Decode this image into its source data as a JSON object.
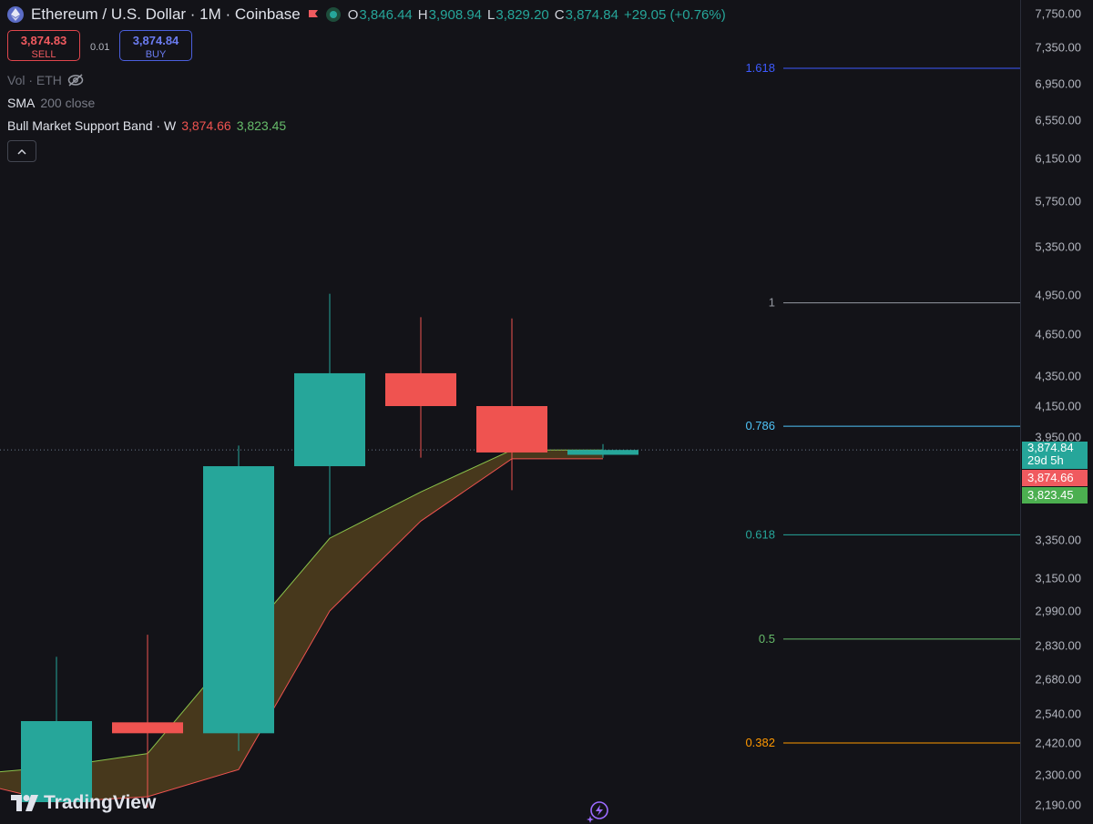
{
  "header": {
    "symbol": "Ethereum / U.S. Dollar · 1M · Coinbase",
    "ohlc": {
      "o_key": "O",
      "o": "3,846.44",
      "h_key": "H",
      "h": "3,908.94",
      "l_key": "L",
      "l": "3,829.20",
      "c_key": "C",
      "c": "3,874.84",
      "change": "+29.05 (+0.76%)"
    }
  },
  "trade": {
    "sell_price": "3,874.83",
    "sell_label": "SELL",
    "spread": "0.01",
    "buy_price": "3,874.84",
    "buy_label": "BUY"
  },
  "legend": {
    "vol": "Vol · ETH",
    "sma_name": "SMA",
    "sma_args": "200 close",
    "bmsb_name": "Bull Market Support Band · W",
    "bmsb_v1": "3,874.66",
    "bmsb_v2": "3,823.45"
  },
  "branding": {
    "logo_text": "TradingView"
  },
  "colors": {
    "up": "#26a69a",
    "down": "#ef5350",
    "band_fill": "#4a3a1c",
    "band_upper": "#8bc34a",
    "band_lower": "#ef5350"
  },
  "axis_ticks": [
    "7,750.00",
    "7,350.00",
    "6,950.00",
    "6,550.00",
    "6,150.00",
    "5,750.00",
    "5,350.00",
    "4,950.00",
    "4,650.00",
    "4,350.00",
    "4,150.00",
    "3,950.00",
    "3,350.00",
    "3,150.00",
    "2,990.00",
    "2,830.00",
    "2,680.00",
    "2,540.00",
    "2,420.00",
    "2,300.00",
    "2,190.00"
  ],
  "price_tags": {
    "last": "3,874.84",
    "countdown": "29d 5h",
    "band_red": "3,874.66",
    "band_green": "3,823.45"
  },
  "chart_data": {
    "type": "candlestick",
    "series": [
      {
        "name": "Ethereum / U.S. Dollar",
        "ohlc": [
          {
            "o": 2200,
            "h": 2780,
            "l": 2180,
            "c": 2510
          },
          {
            "o": 2505,
            "h": 2880,
            "l": 2180,
            "c": 2460
          },
          {
            "o": 2460,
            "h": 3900,
            "l": 2390,
            "c": 3780
          },
          {
            "o": 3780,
            "h": 4960,
            "l": 3380,
            "c": 4370
          },
          {
            "o": 4370,
            "h": 4780,
            "l": 3830,
            "c": 4150
          },
          {
            "o": 4150,
            "h": 4770,
            "l": 3640,
            "c": 3860
          },
          {
            "o": 3846.44,
            "h": 3908.94,
            "l": 3829.2,
            "c": 3874.84
          }
        ]
      },
      {
        "name": "Bull Market Support Band upper",
        "values": [
          2300,
          2330,
          2380,
          2830,
          3360,
          3630,
          3874.66,
          3874.66
        ]
      },
      {
        "name": "Bull Market Support Band lower",
        "values": [
          2280,
          2200,
          2220,
          2320,
          2990,
          3460,
          3823.45,
          3823.45
        ]
      }
    ],
    "fib_levels": [
      {
        "label": "1.618",
        "price": 7120,
        "color": "#3d5afe"
      },
      {
        "label": "1",
        "price": 4890,
        "color": "#9598a1"
      },
      {
        "label": "0.786",
        "price": 4020,
        "color": "#4fc3f7"
      },
      {
        "label": "0.618",
        "price": 3380,
        "color": "#26a69a"
      },
      {
        "label": "0.5",
        "price": 2860,
        "color": "#66bb6a"
      },
      {
        "label": "0.382",
        "price": 2420,
        "color": "#ff9800"
      }
    ],
    "last_price": 3874.84
  }
}
